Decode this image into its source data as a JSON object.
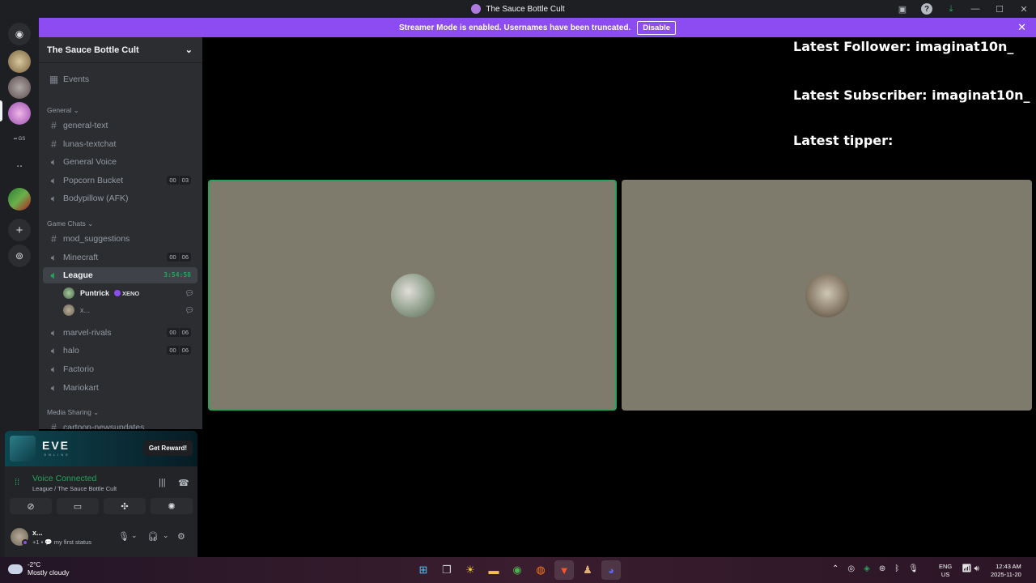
{
  "window": {
    "title": "The Sauce Bottle Cult"
  },
  "banner": {
    "message": "Streamer Mode is enabled. Usernames have been truncated.",
    "disable_label": "Disable"
  },
  "guild": {
    "name": "The Sauce Bottle Cult"
  },
  "channels": {
    "events": "Events",
    "cat_general": "General",
    "general_text": "general-text",
    "lunas_textchat": "lunas-textchat",
    "general_voice": "General Voice",
    "popcorn_bucket": "Popcorn Bucket",
    "popcorn_count": [
      "00",
      "03"
    ],
    "bodypillow": "Bodypillow (AFK)",
    "cat_game": "Game Chats",
    "mod_suggestions": "mod_suggestions",
    "minecraft": "Minecraft",
    "minecraft_count": [
      "00",
      "06"
    ],
    "league": "League",
    "league_timer": "3:54:58",
    "marvel_rivals": "marvel-rivals",
    "marvel_count": [
      "00",
      "06"
    ],
    "halo": "halo",
    "halo_count": [
      "00",
      "06"
    ],
    "factorio": "Factorio",
    "mariokart": "Mariokart",
    "cat_media": "Media Sharing",
    "cartoon": "cartoon-newsupdates"
  },
  "voice_users": [
    {
      "name": "Puntrick",
      "tag": "XENO"
    },
    {
      "name": "x..."
    }
  ],
  "promo": {
    "brand": "EVE",
    "sub": "ONLINE",
    "button": "Get Reward!"
  },
  "voice_panel": {
    "status": "Voice Connected",
    "location": "League / The Sauce Bottle Cult"
  },
  "user_panel": {
    "name": "x...",
    "status": "+1 • 💬 my first status"
  },
  "overlay": {
    "follower": "Latest Follower: imaginat10n_",
    "subscriber": "Latest Subscriber: imaginat10n_",
    "tipper": "Latest tipper:"
  },
  "taskbar": {
    "temp": "-2°C",
    "weather": "Mostly cloudy",
    "lang_1": "ENG",
    "lang_2": "US",
    "time": "12:43 AM",
    "date": "2025-11-20"
  },
  "colors": {
    "accent": "#8c4cf2",
    "voice_green": "#23a55a",
    "tile": "#7e7a6c"
  }
}
